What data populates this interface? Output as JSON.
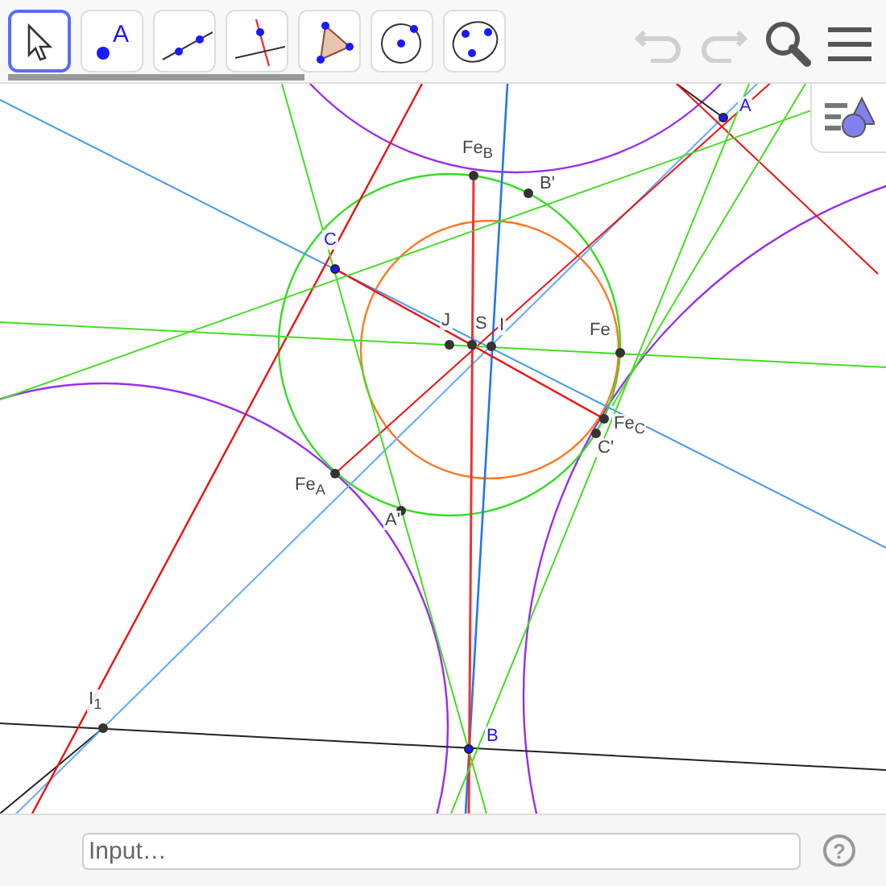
{
  "toolbar": {
    "tools": [
      {
        "kind": "move",
        "selected": true
      },
      {
        "kind": "point",
        "selected": false,
        "label": "A"
      },
      {
        "kind": "line",
        "selected": false
      },
      {
        "kind": "perpendicular",
        "selected": false
      },
      {
        "kind": "polygon",
        "selected": false
      },
      {
        "kind": "circle",
        "selected": false
      },
      {
        "kind": "conic",
        "selected": false
      }
    ],
    "undo": {
      "disabled": true
    },
    "redo": {
      "disabled": true
    }
  },
  "canvas": {
    "points": [
      {
        "label": "A",
        "kind": "vertex"
      },
      {
        "label": "B",
        "kind": "vertex"
      },
      {
        "label": "C",
        "kind": "vertex"
      },
      {
        "label": "Fe$_{B}$",
        "kind": "point"
      },
      {
        "label": "B'",
        "kind": "point"
      },
      {
        "label": "J",
        "kind": "point"
      },
      {
        "label": "S",
        "kind": "point"
      },
      {
        "label": "I",
        "kind": "point"
      },
      {
        "label": "Fe",
        "kind": "point"
      },
      {
        "label": "Fe$_{C}$",
        "kind": "point"
      },
      {
        "label": "C'",
        "kind": "point"
      },
      {
        "label": "Fe$_{A}$",
        "kind": "point"
      },
      {
        "label": "A'",
        "kind": "point"
      },
      {
        "label": "I$_{1}$",
        "kind": "point"
      }
    ]
  },
  "input_bar": {
    "placeholder": "Input…",
    "help": "?"
  }
}
